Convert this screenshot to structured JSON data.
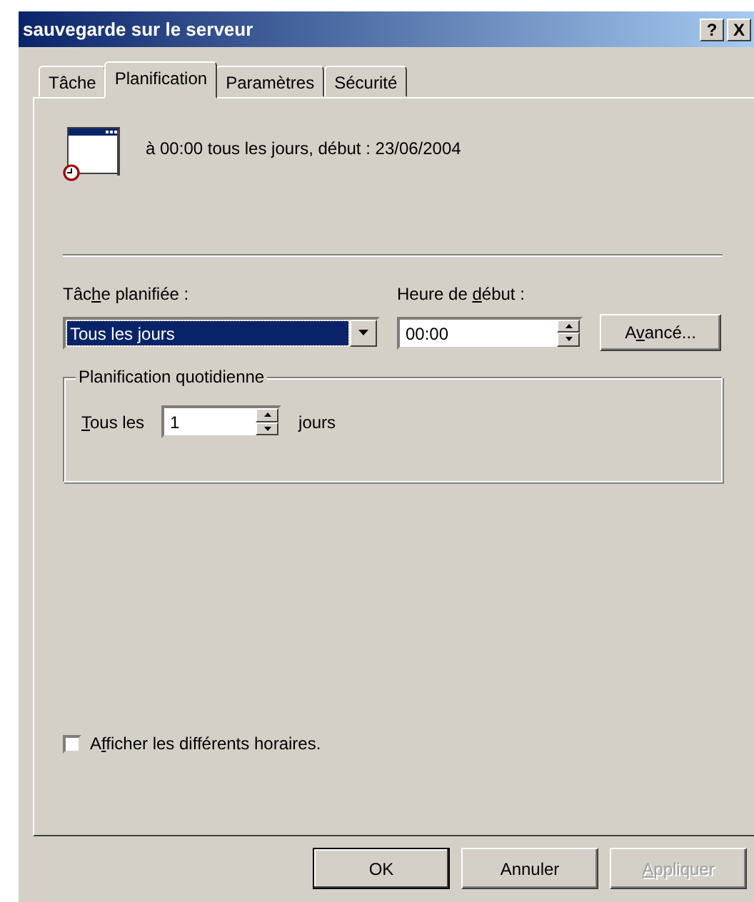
{
  "window": {
    "title": "sauvegarde sur le serveur",
    "help_button": "?",
    "close_button": "X"
  },
  "tabs": [
    {
      "label": "Tâche",
      "selected": false
    },
    {
      "label": "Planification",
      "selected": true
    },
    {
      "label": "Paramètres",
      "selected": false
    },
    {
      "label": "Sécurité",
      "selected": false
    }
  ],
  "summary": "à 00:00 tous les jours, début : 23/06/2004",
  "schedule": {
    "label": {
      "before": "Tâc",
      "key": "h",
      "after": "e planifiée :"
    },
    "value": "Tous les jours",
    "focused": true
  },
  "start_time": {
    "label": {
      "before": "Heure de ",
      "key": "d",
      "after": "ébut :"
    },
    "value": "00:00"
  },
  "advanced_button": {
    "before": "A",
    "key": "v",
    "after": "ancé..."
  },
  "daily_group": {
    "title": "Planification quotidienne",
    "label": {
      "key": "T",
      "after": "ous les"
    },
    "value": "1",
    "unit": "jours"
  },
  "show_multiple": {
    "label": {
      "before": "A",
      "key": "f",
      "after": "ficher les différents horaires."
    },
    "checked": false
  },
  "buttons": [
    {
      "label": {
        "after": "OK"
      },
      "default": true,
      "disabled": false
    },
    {
      "label": {
        "after": "Annuler"
      },
      "default": false,
      "disabled": false
    },
    {
      "label": {
        "key": "A",
        "after": "ppliquer"
      },
      "default": false,
      "disabled": true
    }
  ]
}
